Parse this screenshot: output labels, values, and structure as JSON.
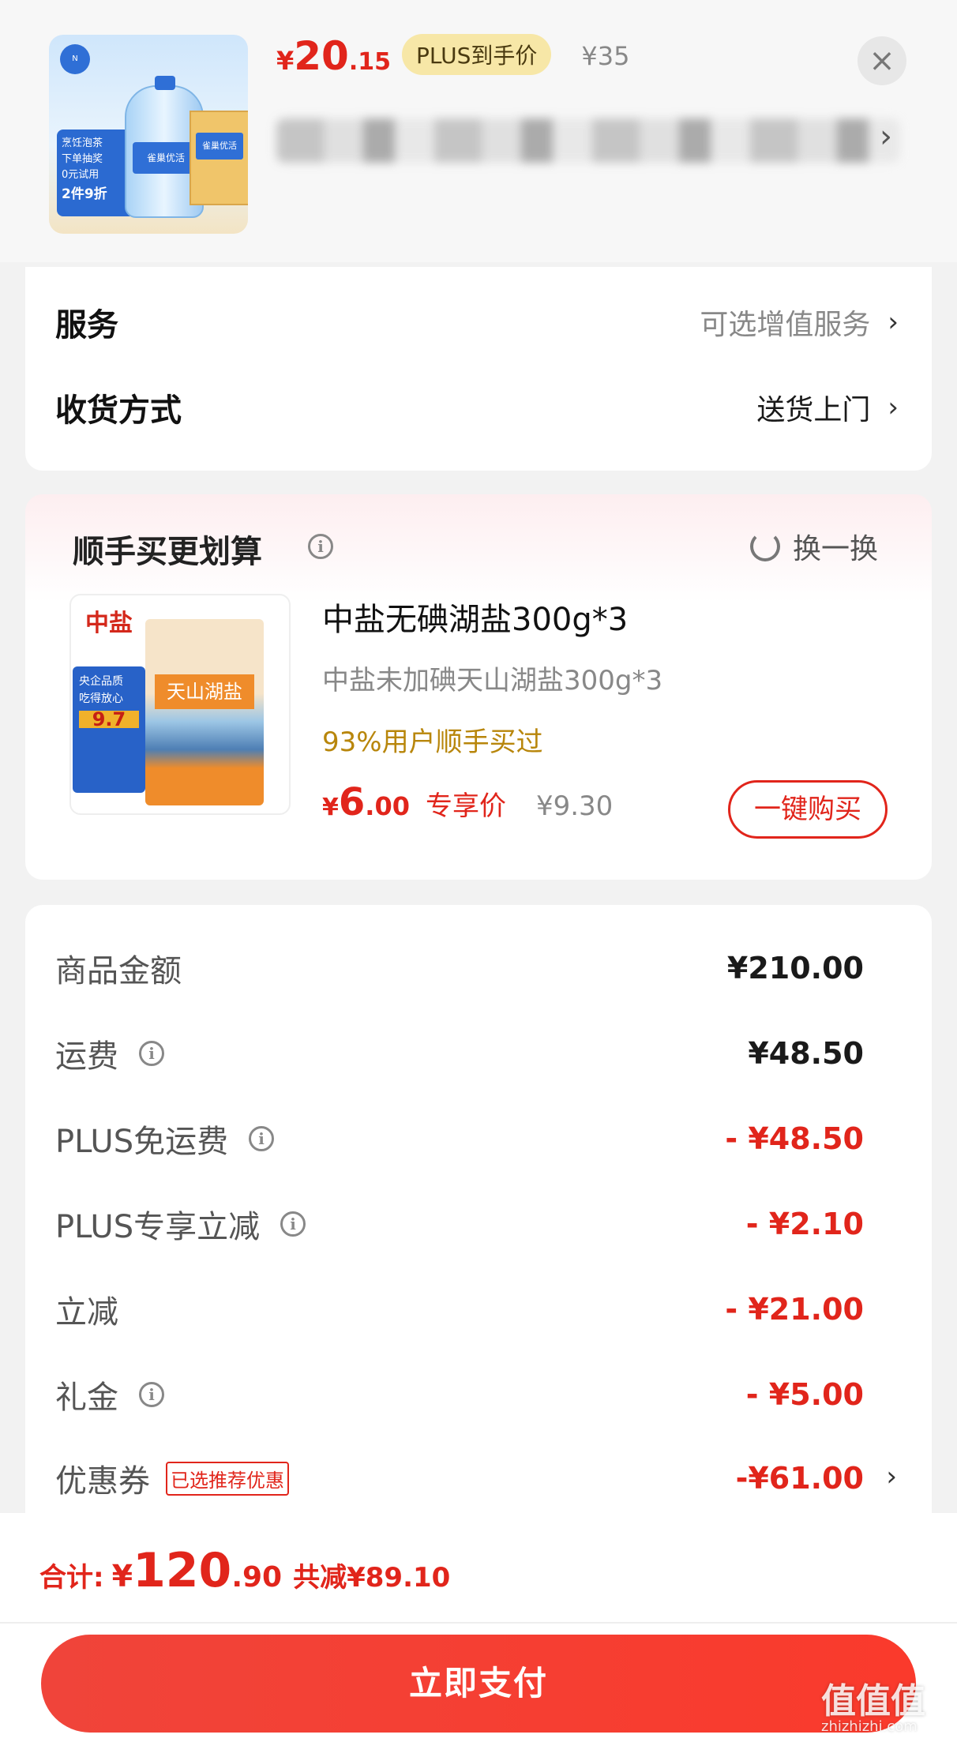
{
  "header": {
    "price_currency": "¥",
    "price_int": "20",
    "price_dec": ".15",
    "plus_label": "PLUS到手价",
    "original_price": "¥35",
    "close_icon": "close-icon",
    "thumb_promo_line1": "烹饪泡茶",
    "thumb_promo_line2": "下单抽奖",
    "thumb_promo_line3": "0元试用",
    "thumb_promo_deal": "2件9折",
    "thumb_bottle_label": "雀巢优活",
    "thumb_box_label": "雀巢优活"
  },
  "service": {
    "rows": [
      {
        "label": "服务",
        "value": "可选增值服务",
        "value_color": "#888888"
      },
      {
        "label": "收货方式",
        "value": "送货上门",
        "value_color": "#1a1a1a"
      }
    ]
  },
  "recommend": {
    "title": "顺手买更划算",
    "refresh_label": "换一换",
    "product_name": "中盐无碘湖盐300g*3",
    "product_sub": "中盐未加碘天山湖盐300g*3",
    "stat": "93%用户顺手买过",
    "price_currency": "¥",
    "price_int": "6",
    "price_dec": ".00",
    "price_tag": "专享价",
    "old_price": "¥9.30",
    "buy_label": "一键购买",
    "thumb_logo": "中盐",
    "thumb_pack_text": "天山湖盐",
    "thumb_side_line1": "央企品质",
    "thumb_side_line2": "吃得放心",
    "thumb_side_score": "9.7"
  },
  "summary": {
    "rows": [
      {
        "label": "商品金额",
        "value": "¥210.00",
        "info": false,
        "red": false
      },
      {
        "label": "运费",
        "value": "¥48.50",
        "info": true,
        "red": false
      },
      {
        "label": "PLUS免运费",
        "value": "- ¥48.50",
        "info": true,
        "red": true
      },
      {
        "label": "PLUS专享立减",
        "value": "- ¥2.10",
        "info": true,
        "red": true
      },
      {
        "label": "立减",
        "value": "- ¥21.00",
        "info": false,
        "red": true
      },
      {
        "label": "礼金",
        "value": "- ¥5.00",
        "info": true,
        "red": true
      }
    ],
    "coupon": {
      "label": "优惠券",
      "tag": "已选推荐优惠",
      "value": "-¥61.00"
    }
  },
  "footer": {
    "total_label": "合计:",
    "total_currency": "¥",
    "total_int": "120",
    "total_dec": ".90",
    "save_text": "共减¥89.10",
    "pay_label": "立即支付",
    "watermark": "值值值",
    "watermark_sub": "zhizhizhi.com"
  },
  "colors": {
    "accent": "#e1251b",
    "plus_pill": "#f7e7a7",
    "pay_button": "#f0443a"
  }
}
